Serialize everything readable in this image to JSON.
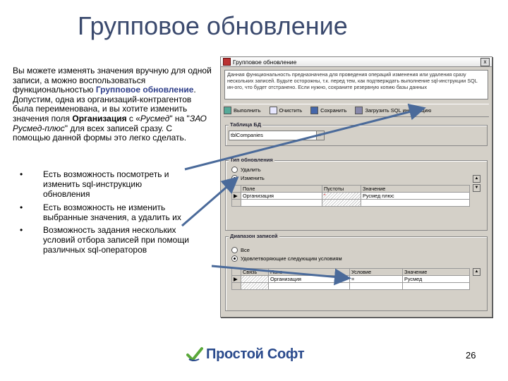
{
  "slide": {
    "title": "Групповое обновление",
    "page_number": "26"
  },
  "intro": {
    "part1": "Вы можете изменять значения вручную для одной записи, а можно воспользоваться функциональностью ",
    "highlight": "Групповое обновление",
    "part2": ". Допустим, одна из организаций-контрагентов была переименована, и вы хотите изменить значения поля ",
    "field": "Организация",
    "part3": " с «",
    "old_value": "Русмед",
    "part4": "\" на \"",
    "new_value": "ЗАО Русмед-плюс",
    "part5": "\" для всех записей сразу. С помощью данной формы это легко сделать."
  },
  "bullets": [
    "Есть возможность посмотреть и изменить sql-инструкцию обновления",
    "Есть возможность не изменить выбранные значения, а удалить их",
    "Возможность задания нескольких условий отбора записей при помощи различных sql-операторов"
  ],
  "logo": {
    "text": "Простой Софт",
    "icon": "check-leaf-icon",
    "color": "#2a4a8c"
  },
  "dialog": {
    "title": "Групповое обновление",
    "close_label": "x",
    "info_text": "Данная функциональность предназначена для проведения операций изменения или удаления сразу нескольких записей. Будьте осторожны, т.к. перед тем, как подтверждать выполнение sql-инструкции SQL ин-ого, что будет отстранено. Если нужно, сохраните резервную копию базы данных",
    "toolbar": [
      {
        "label": "Выполнить",
        "icon": "run-icon"
      },
      {
        "label": "Очистить",
        "icon": "clear-icon"
      },
      {
        "label": "Сохранить",
        "icon": "save-icon"
      },
      {
        "label": "Загрузить SQL инструкцию",
        "icon": "load-sql-icon"
      }
    ],
    "table_group": {
      "label": "Таблица БД",
      "selected": "tblCompanies"
    },
    "action_group": {
      "label": "Тип обновления",
      "options": [
        "Удалить",
        "Изменить"
      ],
      "selected_index": 1,
      "columns": [
        "Поле",
        "Пустоты",
        "Значение"
      ],
      "rows": [
        [
          "Организация",
          "\"",
          "Русмед плюс"
        ]
      ]
    },
    "range_group": {
      "label": "Диапазон записей",
      "options": [
        "Все",
        "Удовлетворяющие следующим условиям"
      ],
      "selected_index": 1,
      "columns": [
        "Связь",
        "Поле",
        "Условие",
        "Значение"
      ],
      "rows": [
        [
          "",
          "Организация",
          "=",
          "Русмед"
        ]
      ]
    }
  }
}
